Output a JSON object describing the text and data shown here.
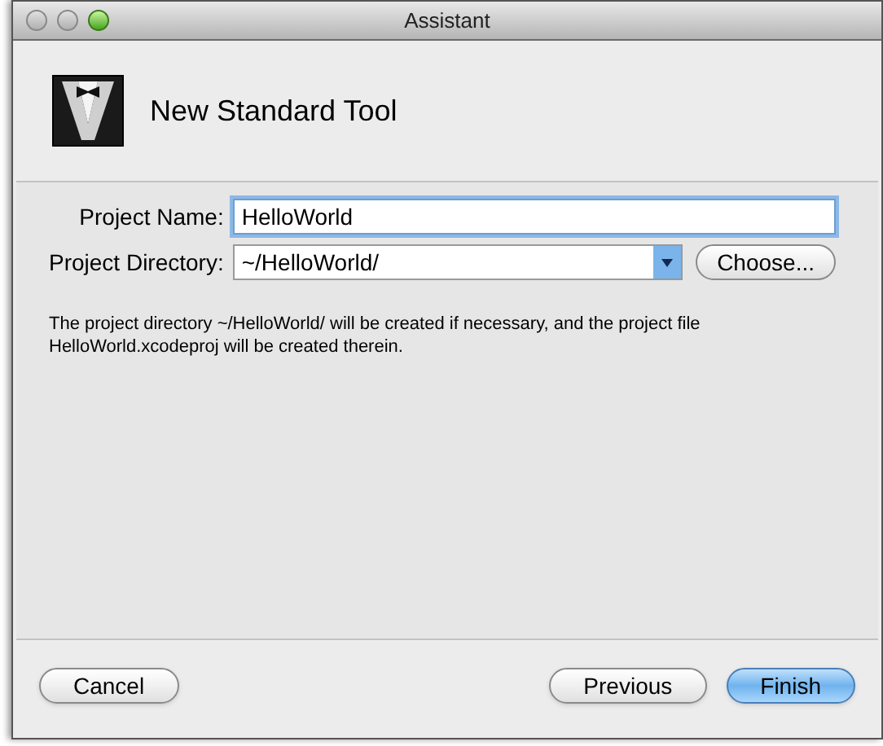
{
  "window": {
    "title": "Assistant"
  },
  "header": {
    "title": "New Standard Tool"
  },
  "form": {
    "fields": [
      {
        "kind": "text",
        "label": "Project Name:",
        "value": "HelloWorld",
        "focused": true
      },
      {
        "kind": "combo",
        "label": "Project Directory:",
        "value": "~/HelloWorld/",
        "button": "Choose..."
      }
    ],
    "note": "The project directory ~/HelloWorld/ will be created if necessary, and the project file HelloWorld.xcodeproj will be created therein."
  },
  "buttons": [
    {
      "label": "Cancel",
      "kind": "default"
    },
    {
      "label": "Previous",
      "kind": "default"
    },
    {
      "label": "Finish",
      "kind": "primary"
    }
  ]
}
